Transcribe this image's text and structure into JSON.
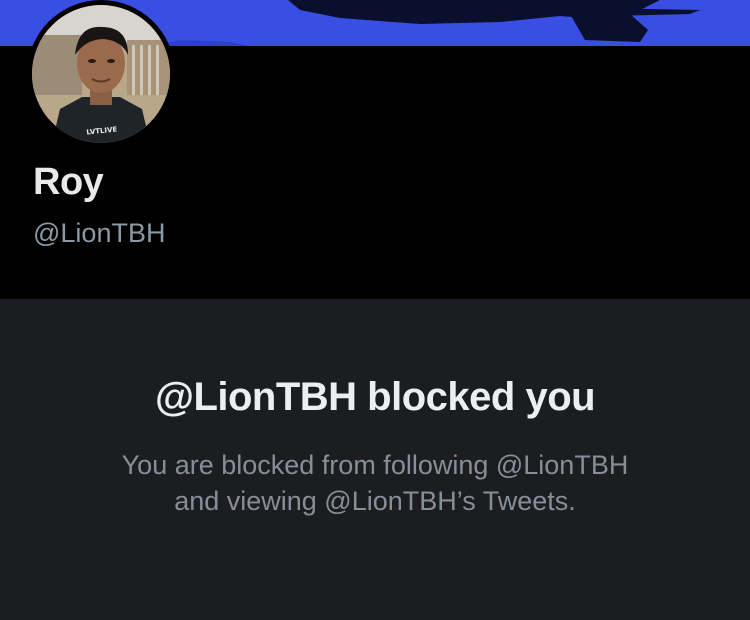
{
  "profile": {
    "display_name": "Roy",
    "handle": "@LionTBH",
    "avatar_shirt_text": "LVTLIVE"
  },
  "blocked_notice": {
    "title": "@LionTBH blocked you",
    "description_line1": "You are blocked from following @LionTBH",
    "description_line2": "and viewing @LionTBH’s Tweets."
  },
  "colors": {
    "banner": "#3349e0",
    "background": "#000000",
    "notice_background": "#1c1d20",
    "title_text": "#eceeef",
    "secondary_text": "#868f99"
  }
}
